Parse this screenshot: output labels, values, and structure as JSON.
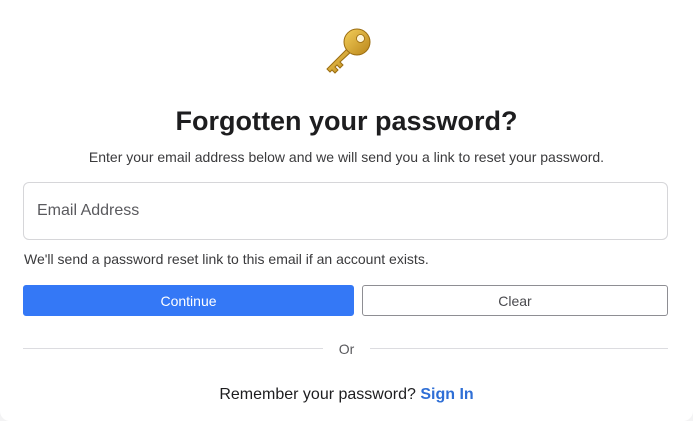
{
  "header": {
    "icon": "key-icon",
    "title": "Forgotten your password?",
    "subtitle": "Enter your email address below and we will send you a link to reset your password."
  },
  "form": {
    "email_placeholder": "Email Address",
    "email_value": "",
    "hint": "We'll send a password reset link to this email if an account exists.",
    "continue_label": "Continue",
    "clear_label": "Clear"
  },
  "divider": {
    "label": "Or"
  },
  "footer": {
    "prompt": "Remember your password?",
    "signin_label": "Sign In"
  },
  "colors": {
    "primary": "#3478f6",
    "link": "#2f6fd6",
    "key": "#d9a521"
  }
}
